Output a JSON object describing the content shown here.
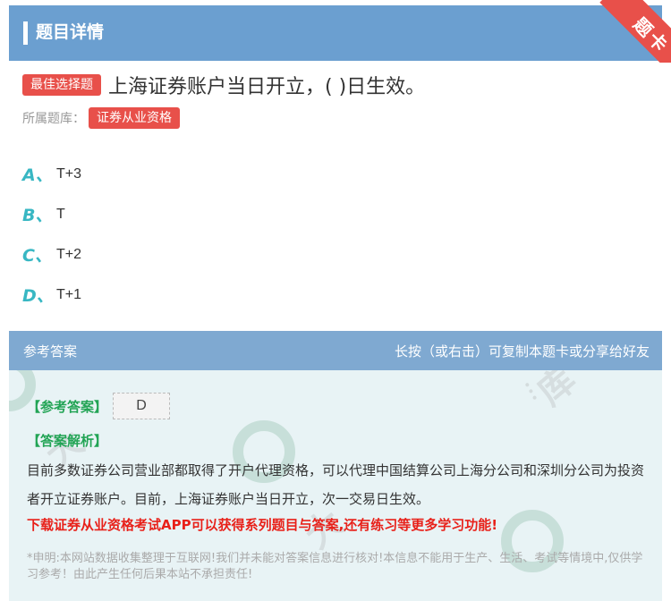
{
  "header": {
    "title": "题目详情",
    "ribbon": "题卡"
  },
  "question": {
    "type_badge": "最佳选择题",
    "text": "上海证券账户当日开立，( )日生效。",
    "bank_label": "所属题库：",
    "bank_name": "证券从业资格"
  },
  "options": [
    {
      "letter": "A、",
      "text": "T+3"
    },
    {
      "letter": "B、",
      "text": "T"
    },
    {
      "letter": "C、",
      "text": "T+2"
    },
    {
      "letter": "D、",
      "text": "T+1"
    }
  ],
  "answer_panel": {
    "title": "参考答案",
    "hint": "长按（或右击）可复制本题卡或分享给好友",
    "ref_label": "【参考答案】",
    "ref_value": "D",
    "analysis_label": "【答案解析】",
    "analysis_text": "目前多数证券公司营业部都取得了开户代理资格，可以代理中国结算公司上海分公司和深圳分公司为投资者开立证券账户。目前，上海证券账户当日开立，次一交易日生效。",
    "promo": "下载证券从业资格考试APP可以获得系列题目与答案,还有练习等更多学习功能!",
    "disclaimer": "*申明:本网站数据收集整理于互联网!我们并未能对答案信息进行核对!本信息不能用于生产、生活、考试等情境中,仅供学习参考！由此产生任何后果本站不承担责任!"
  },
  "colors": {
    "header": "#6b9fd0",
    "badge": "#e8504a",
    "option_letter": "#38b7c3",
    "answer_label": "#22a455",
    "promo": "#e8211a"
  }
}
